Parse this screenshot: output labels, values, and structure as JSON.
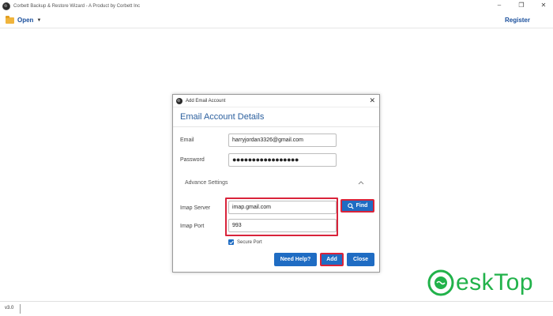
{
  "app": {
    "title": "Corbett Backup & Restore Wizard - A Product by Corbett Inc",
    "window_controls": {
      "minimize": "–",
      "restore": "❐",
      "close": "✕"
    }
  },
  "menubar": {
    "open_label": "Open",
    "open_icon": "folder-open-icon",
    "register_label": "Register"
  },
  "dialog": {
    "title": "Add Email Account",
    "heading": "Email Account Details",
    "close_glyph": "✕",
    "email": {
      "label": "Email",
      "value": "harryjordan3326@gmail.com"
    },
    "password": {
      "label": "Password",
      "value": "●●●●●●●●●●●●●●●●●"
    },
    "advance_settings_label": "Advance Settings",
    "imap_server": {
      "label": "Imap Server",
      "value": "imap.gmail.com"
    },
    "imap_port": {
      "label": "Imap Port",
      "value": "993"
    },
    "find_label": "Find",
    "secure_port": {
      "label": "Secure Port",
      "checked": true
    },
    "buttons": {
      "help": "Need Help?",
      "add": "Add",
      "close": "Close"
    }
  },
  "statusbar": {
    "version": "v3.0"
  },
  "watermark": {
    "text": "eskTop"
  },
  "colors": {
    "accent": "#1f6cc3",
    "highlight": "#d9233a",
    "heading": "#2b5f9e",
    "watermark": "#21b24a"
  }
}
